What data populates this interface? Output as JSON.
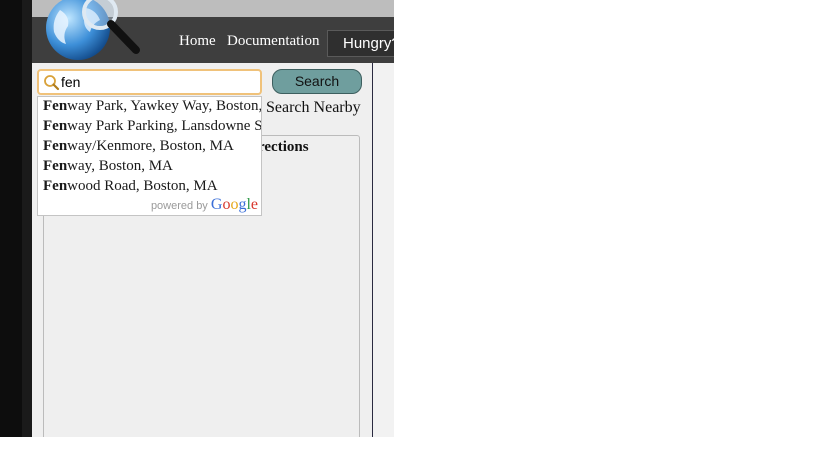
{
  "header": {
    "nav": [
      {
        "label": "Home"
      },
      {
        "label": "Documentation"
      }
    ],
    "hungry_tab": "Hungry?"
  },
  "search": {
    "value": "fen",
    "button_label": "Search",
    "nearby_label": "Search Nearby"
  },
  "directions": {
    "title_visible": "rections"
  },
  "autocomplete": {
    "items": [
      {
        "match": "Fen",
        "rest": "way Park, Yawkey Way, Boston, MA"
      },
      {
        "match": "Fen",
        "rest": "way Park Parking, Lansdowne Street, Boston, MA"
      },
      {
        "match": "Fen",
        "rest": "way/Kenmore, Boston, MA"
      },
      {
        "match": "Fen",
        "rest": "way, Boston, MA"
      },
      {
        "match": "Fen",
        "rest": "wood Road, Boston, MA"
      }
    ],
    "powered_by": "powered by",
    "google": [
      "G",
      "o",
      "o",
      "g",
      "l",
      "e"
    ]
  },
  "colors": {
    "header_bg": "#3e3e3e",
    "search_button": "#6f9e9e",
    "search_border": "#f0c27a"
  }
}
